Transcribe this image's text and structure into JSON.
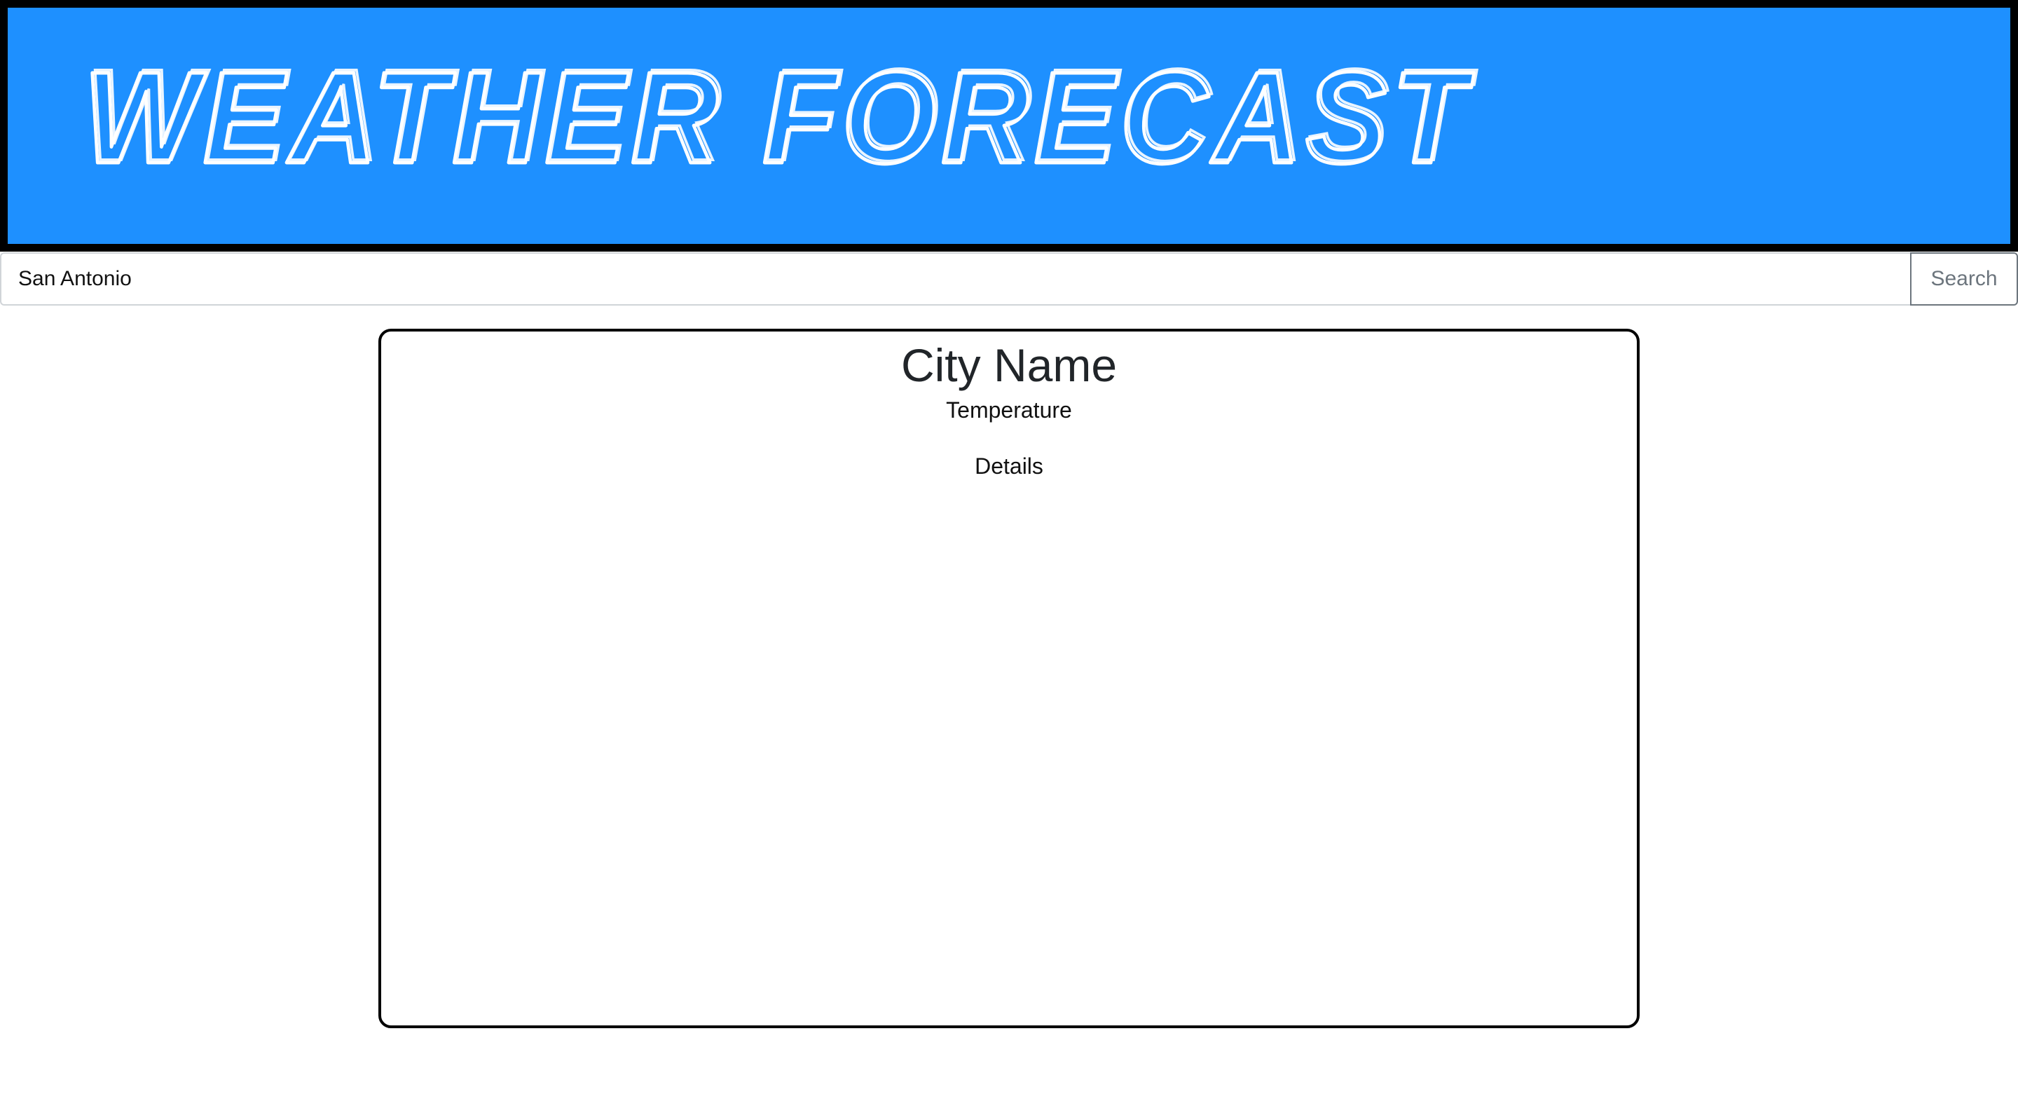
{
  "header": {
    "title": "WEATHER FORECAST",
    "background_color": "#1e90ff",
    "border_color": "#000000",
    "title_color": "#ffffff"
  },
  "search": {
    "value": "San Antonio",
    "placeholder": "",
    "button_label": "Search"
  },
  "card": {
    "city_name": "City Name",
    "temperature": "Temperature",
    "details": "Details"
  }
}
